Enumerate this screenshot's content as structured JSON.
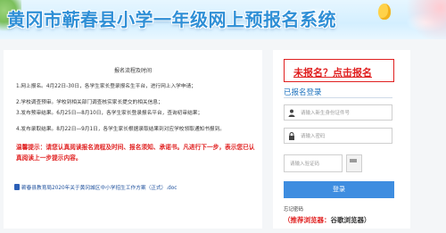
{
  "header": {
    "title": "黄冈市蕲春县小学一年级网上预报名系统"
  },
  "left": {
    "title": "报名流程及时间",
    "steps": [
      "1.网上报名。4月22日-30日，各学生家长登录报名生平台，进行网上入学申请；",
      "2.学校调查预审。学校到相关部门调查核实家长提交的相关信息；",
      "3.发布预审结果。6月25日—8月10日，各学生家长登录报名平台，查询初审结果；",
      "4.发布录取结果。8月22日—9月1日，各学生家长根据录取结果到对应学校领取通知书报到。"
    ],
    "notice": "温馨提示：请您认真阅读报名流程及时间、报名须知、承诺书。凡进行下一步，表示您已认真阅读上一步提示内容。",
    "doc_link": "蕲春县教育局2020年关于黄冈城区中小学招生工作方案（正式）.doc"
  },
  "right": {
    "register_link": "未报名？点击报名",
    "login_title": "已报名登录",
    "id_placeholder": "请输入新生身份证件号",
    "password_placeholder": "请输入密码",
    "captcha_placeholder": "请输入验证码",
    "login_button": "登录",
    "forgot_password": "忘记密码",
    "browser_tip_label": "（推荐浏览器：",
    "browser_tip_value": "谷歌浏览器）"
  },
  "colors": {
    "title": "#2f8fd6",
    "accent_red": "#e02020",
    "link_blue": "#1e73be",
    "button_blue": "#3e8de0"
  },
  "icons": {
    "user": "user-icon",
    "lock": "lock-icon",
    "doc": "doc-icon"
  }
}
